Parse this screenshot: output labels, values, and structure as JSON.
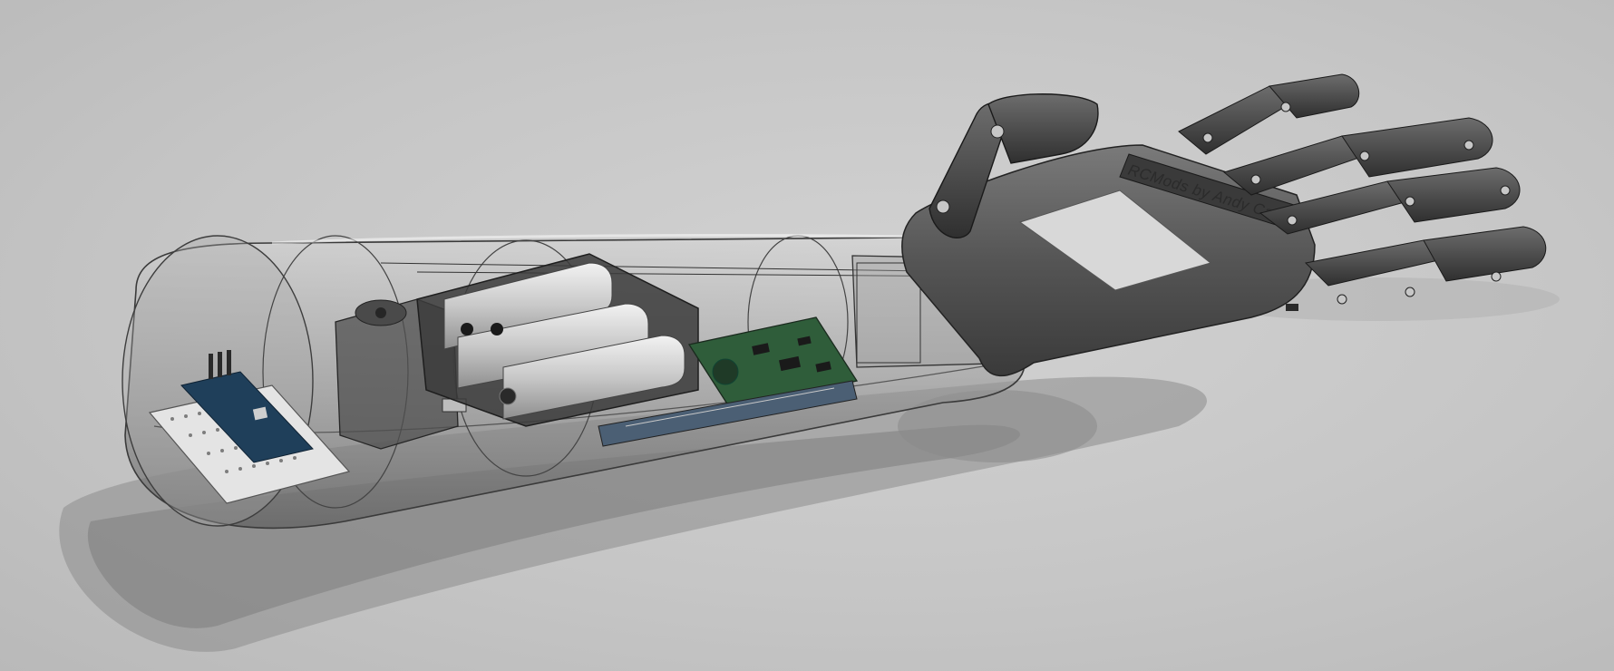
{
  "scene": {
    "background_color": "#c4c4c4",
    "shell_color": "#8a8a8a",
    "hand_color": "#555555",
    "pcb_color": "#2f5d3a",
    "battery_color": "#d9d9d9"
  },
  "palm": {
    "engraving": "RCMods by Andy Carter"
  },
  "icons": [
    "prosthetic-arm-icon",
    "robotic-hand-icon",
    "battery-icon",
    "circuit-board-icon",
    "servo-icon"
  ]
}
